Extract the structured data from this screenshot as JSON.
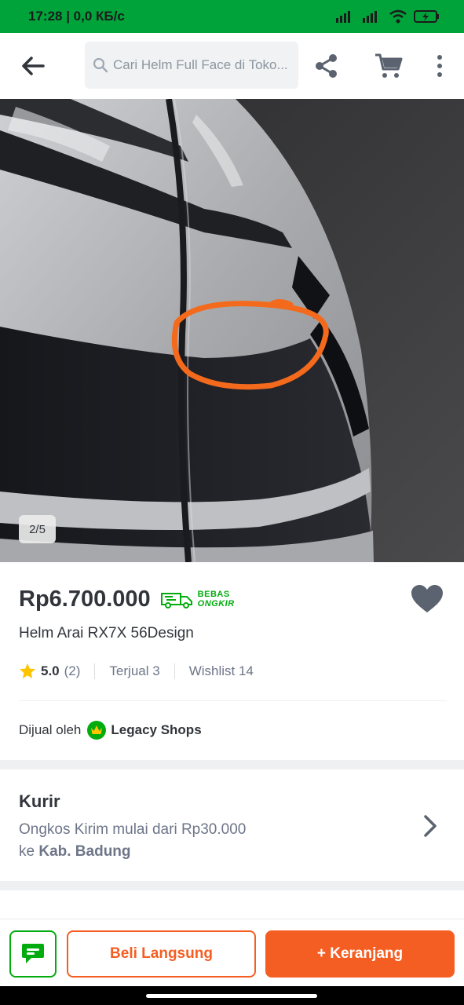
{
  "status_bar": {
    "time_speed": "17:28 | 0,0 КБ/с"
  },
  "header": {
    "search_placeholder": "Cari Helm Full Face di Toko..."
  },
  "gallery": {
    "counter": "2/5"
  },
  "product": {
    "price": "Rp6.700.000",
    "free_shipping_line1": "BEBAS",
    "free_shipping_line2": "ONGKIR",
    "name": "Helm Arai RX7X 56Design",
    "rating": "5.0",
    "rating_count": "(2)",
    "sold": "Terjual 3",
    "wishlist": "Wishlist 14"
  },
  "seller": {
    "prefix": "Dijual oleh",
    "name": "Legacy Shops"
  },
  "courier": {
    "title": "Kurir",
    "line1": "Ongkos Kirim mulai dari Rp30.000",
    "line2_prefix": "ke",
    "line2_place": "Kab. Badung"
  },
  "actions": {
    "buy_now": "Beli Langsung",
    "add_to_cart": "+ Keranjang"
  },
  "colors": {
    "brand_green": "#03ac0e",
    "status_green": "#00a33a",
    "orange": "#f55e22",
    "text": "#31353b",
    "muted": "#6d7588"
  }
}
